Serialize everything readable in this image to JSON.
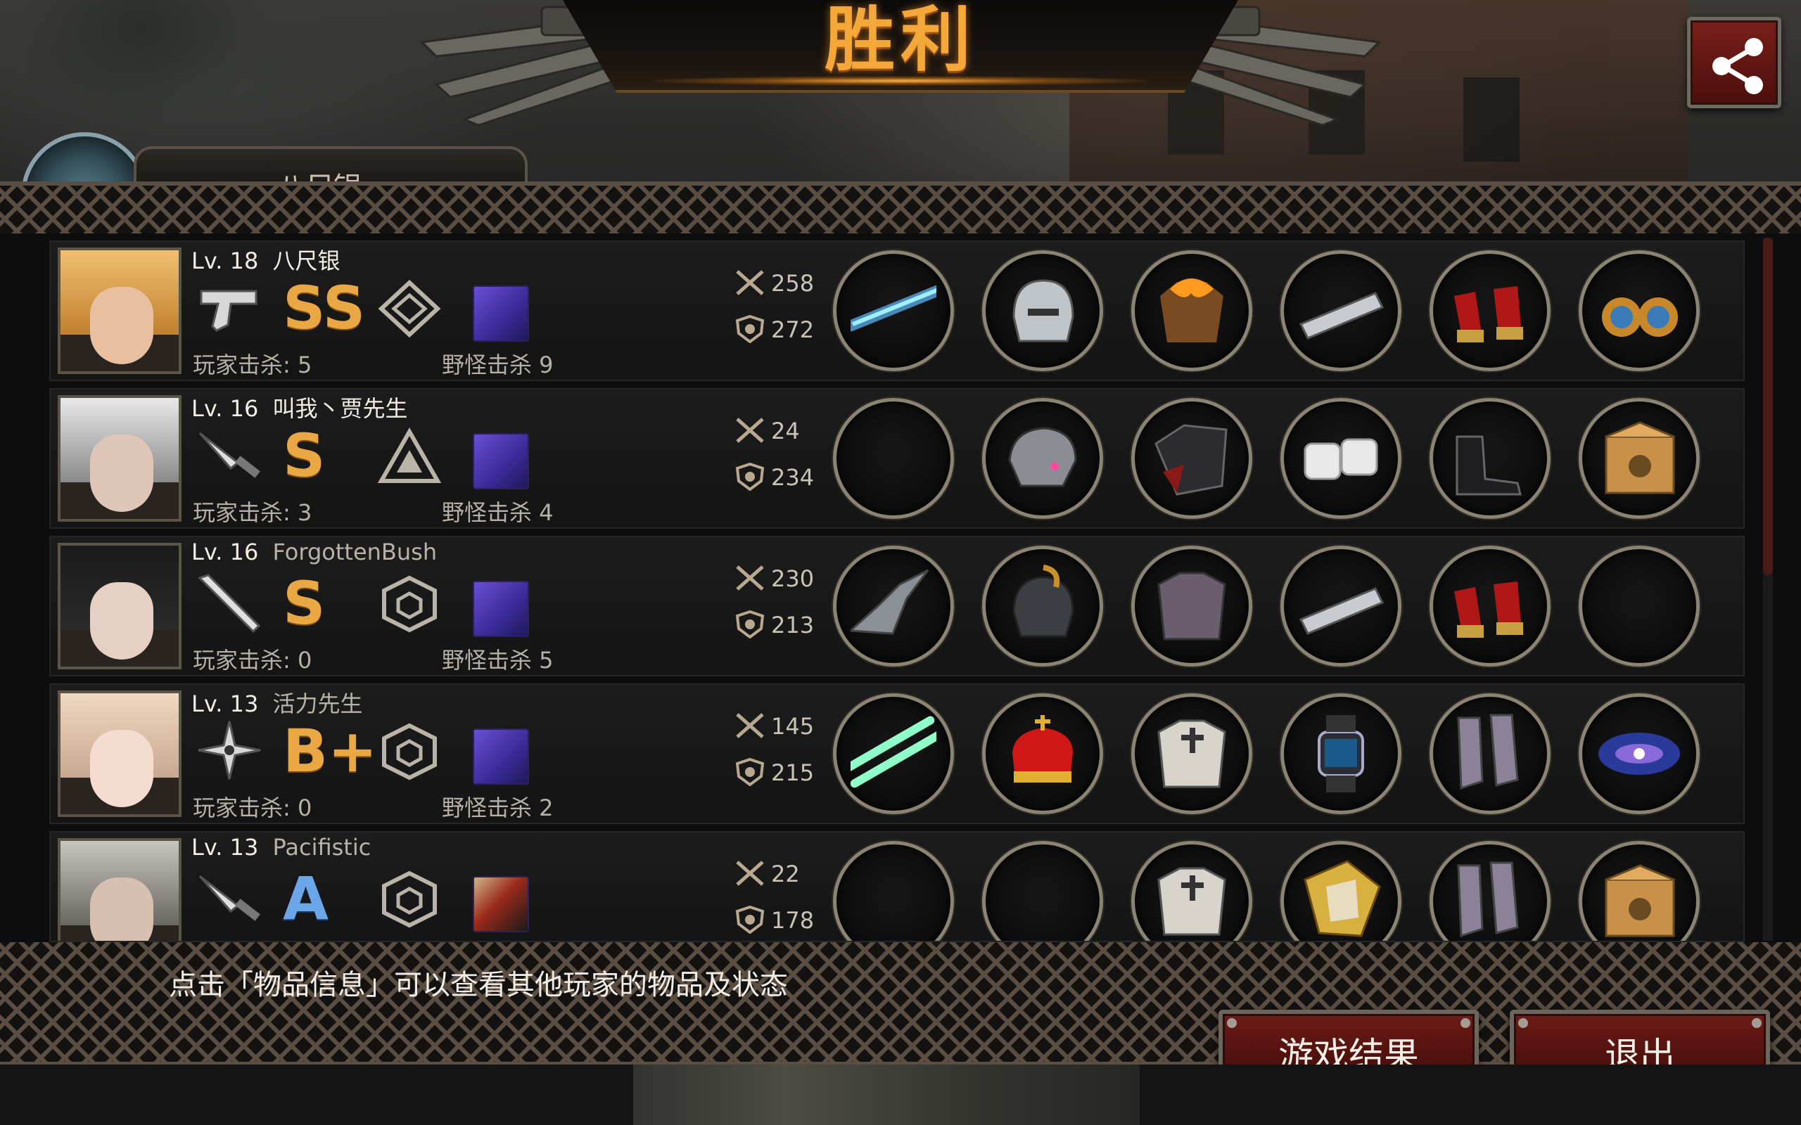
{
  "title": "胜利",
  "peek_tab_label": "八尺银",
  "hint": "点击「物品信息」可以查看其他玩家的物品及状态",
  "buttons": {
    "game_result": "游戏结果",
    "exit": "退出"
  },
  "players": [
    {
      "level": "Lv. 18",
      "name": "八尺银",
      "weapon_icon": "pistol-icon",
      "grade": "SS",
      "rank_icon": "diamond-rank-icon",
      "monster_icon": "purple-monster-icon",
      "player_kills_label": "玩家击杀: 5",
      "monster_kills_label": "野怪击杀 9",
      "attack": "258",
      "defense": "272",
      "items": [
        "laser-rifle-icon",
        "silver-helmet-icon",
        "flaming-armor-icon",
        "spiked-bracer-icon",
        "red-heels-icon",
        "gem-earrings-icon"
      ]
    },
    {
      "level": "Lv. 16",
      "name": "叫我丶贾先生",
      "weapon_icon": "knife-icon",
      "grade": "S",
      "rank_icon": "triangle-rank-icon",
      "monster_icon": "purple-monster-icon",
      "player_kills_label": "玩家击杀: 3",
      "monster_kills_label": "野怪击杀 4",
      "attack": "24",
      "defense": "234",
      "items": [
        "empty",
        "tech-helmet-icon",
        "dark-jacket-icon",
        "white-bandage-icon",
        "combat-boots-icon",
        "cat-box-icon"
      ]
    },
    {
      "level": "Lv. 16",
      "name": "ForgottenBush",
      "weapon_icon": "bat-icon",
      "grade": "S",
      "rank_icon": "hexagon-rank-icon",
      "monster_icon": "purple-monster-icon",
      "player_kills_label": "玩家击杀: 0",
      "monster_kills_label": "野怪击杀 5",
      "attack": "230",
      "defense": "213",
      "items": [
        "statue-weapon-icon",
        "knight-helmet-icon",
        "plate-armor-icon",
        "spiked-bracer-icon",
        "red-heels-icon",
        "empty"
      ]
    },
    {
      "level": "Lv. 13",
      "name": "活力先生",
      "weapon_icon": "shuriken-icon",
      "grade": "B+",
      "rank_icon": "hexagon-rank-icon",
      "monster_icon": "purple-monster-icon",
      "player_kills_label": "玩家击杀: 0",
      "monster_kills_label": "野怪击杀 2",
      "attack": "145",
      "defense": "215",
      "items": [
        "dual-lightsaber-icon",
        "royal-crown-icon",
        "cross-armor-icon",
        "smart-watch-icon",
        "tall-boots-icon",
        "galaxy-icon"
      ]
    },
    {
      "level": "Lv. 13",
      "name": "Pacifistic",
      "weapon_icon": "knife-icon",
      "grade": "A",
      "rank_icon": "hexagon-rank-icon",
      "monster_icon": "fighter-icon",
      "player_kills_label": "",
      "monster_kills_label": "",
      "attack": "22",
      "defense": "178",
      "items": [
        "empty",
        "empty",
        "cross-armor-icon",
        "golden-shield-icon",
        "tall-boots-icon",
        "cat-box-icon"
      ]
    }
  ],
  "colors": {
    "accent_title": "#f4a83a",
    "grade_gold": "#e9a844",
    "grade_blue": "#6aa6e8",
    "button_red": "#6e1b17"
  }
}
